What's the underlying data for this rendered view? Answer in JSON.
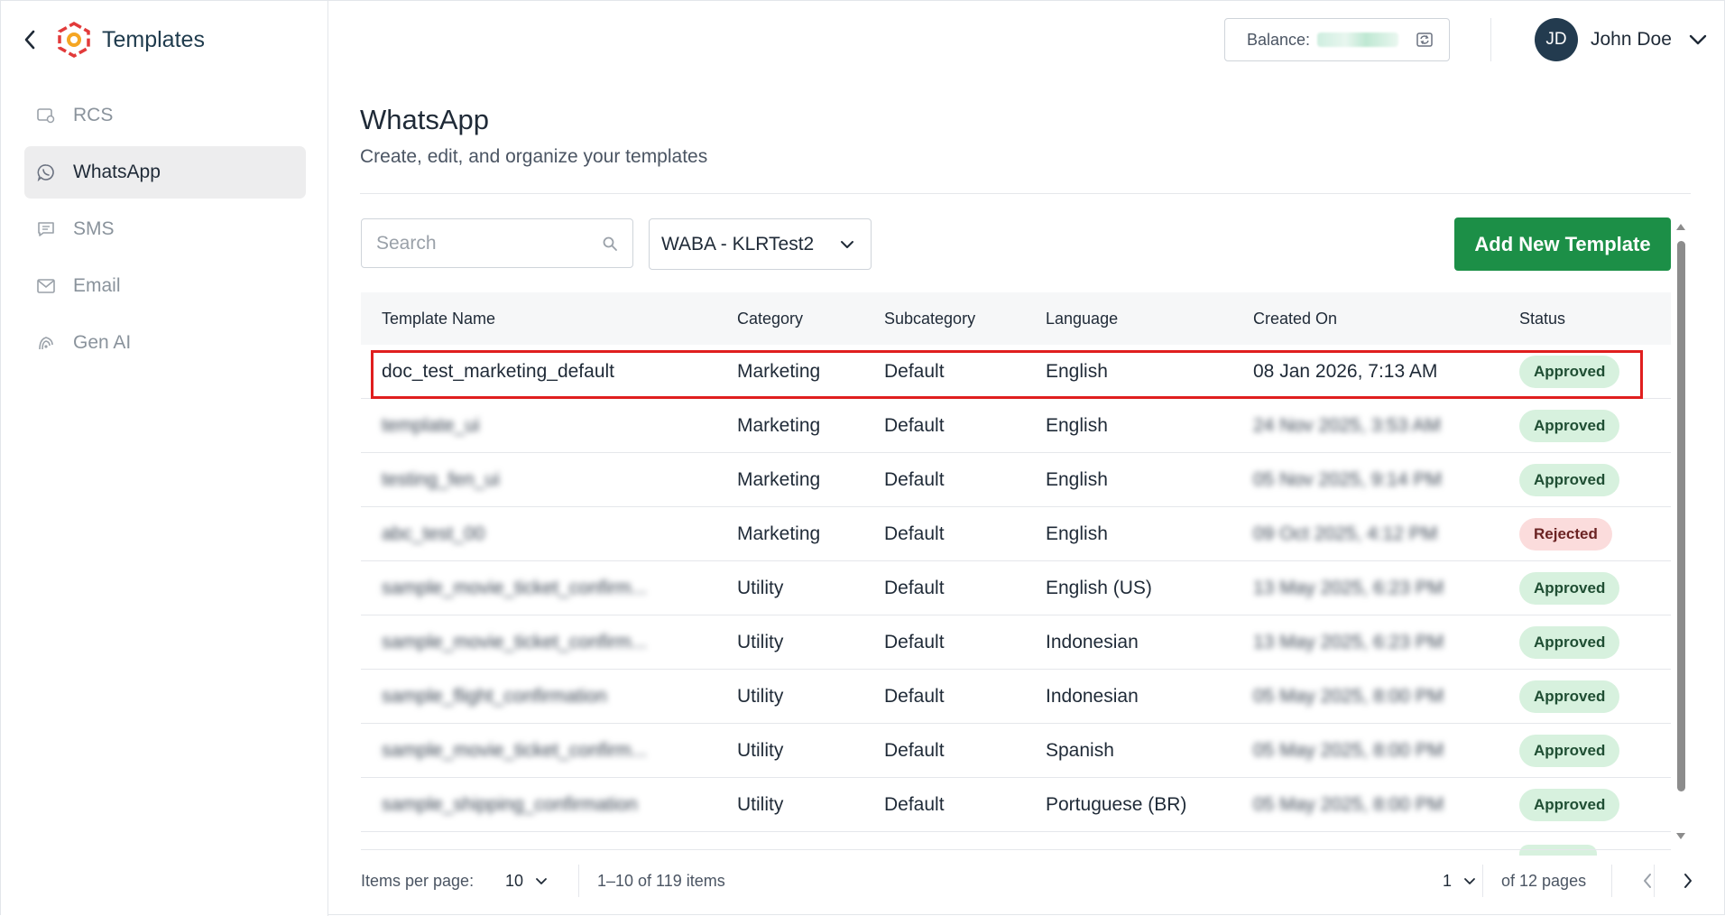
{
  "sidebar": {
    "title": "Templates",
    "items": [
      {
        "label": "RCS",
        "icon": "rcs-icon"
      },
      {
        "label": "WhatsApp",
        "icon": "whatsapp-icon"
      },
      {
        "label": "SMS",
        "icon": "sms-icon"
      },
      {
        "label": "Email",
        "icon": "email-icon"
      },
      {
        "label": "Gen AI",
        "icon": "gen-ai-icon"
      }
    ],
    "active_index": 1
  },
  "topbar": {
    "balance_label": "Balance:",
    "user_initials": "JD",
    "user_name": "John Doe"
  },
  "main": {
    "title": "WhatsApp",
    "subtitle": "Create, edit, and organize your templates",
    "search_placeholder": "Search",
    "waba_selected": "WABA - KLRTest2",
    "add_button": "Add New Template"
  },
  "table": {
    "columns": [
      "Template Name",
      "Category",
      "Subcategory",
      "Language",
      "Created On",
      "Status"
    ],
    "rows": [
      {
        "name": "doc_test_marketing_default",
        "category": "Marketing",
        "subcategory": "Default",
        "language": "English",
        "created": "08 Jan 2026, 7:13 AM",
        "status": "Approved",
        "obscured": false
      },
      {
        "name": "template_ui",
        "category": "Marketing",
        "subcategory": "Default",
        "language": "English",
        "created": "24 Nov 2025, 3:53 AM",
        "status": "Approved",
        "obscured": true
      },
      {
        "name": "testing_fen_ui",
        "category": "Marketing",
        "subcategory": "Default",
        "language": "English",
        "created": "05 Nov 2025, 9:14 PM",
        "status": "Approved",
        "obscured": true
      },
      {
        "name": "abc_test_00",
        "category": "Marketing",
        "subcategory": "Default",
        "language": "English",
        "created": "09 Oct 2025, 4:12 PM",
        "status": "Rejected",
        "obscured": true
      },
      {
        "name": "sample_movie_ticket_confirm...",
        "category": "Utility",
        "subcategory": "Default",
        "language": "English (US)",
        "created": "13 May 2025, 6:23 PM",
        "status": "Approved",
        "obscured": true
      },
      {
        "name": "sample_movie_ticket_confirm...",
        "category": "Utility",
        "subcategory": "Default",
        "language": "Indonesian",
        "created": "13 May 2025, 6:23 PM",
        "status": "Approved",
        "obscured": true
      },
      {
        "name": "sample_flight_confirmation",
        "category": "Utility",
        "subcategory": "Default",
        "language": "Indonesian",
        "created": "05 May 2025, 8:00 PM",
        "status": "Approved",
        "obscured": true
      },
      {
        "name": "sample_movie_ticket_confirm...",
        "category": "Utility",
        "subcategory": "Default",
        "language": "Spanish",
        "created": "05 May 2025, 8:00 PM",
        "status": "Approved",
        "obscured": true
      },
      {
        "name": "sample_shipping_confirmation",
        "category": "Utility",
        "subcategory": "Default",
        "language": "Portuguese (BR)",
        "created": "05 May 2025, 8:00 PM",
        "status": "Approved",
        "obscured": true
      }
    ]
  },
  "pagination": {
    "items_per_page_label": "Items per page:",
    "items_per_page": "10",
    "range": "1–10 of 119 items",
    "current_page": "1",
    "of_pages": "of 12 pages"
  },
  "colors": {
    "primary_button": "#1c8f47",
    "approved_bg": "#d7f1de",
    "rejected_bg": "#fbdcdc",
    "highlight_border": "#e01e1e",
    "avatar_bg": "#233b4f"
  }
}
